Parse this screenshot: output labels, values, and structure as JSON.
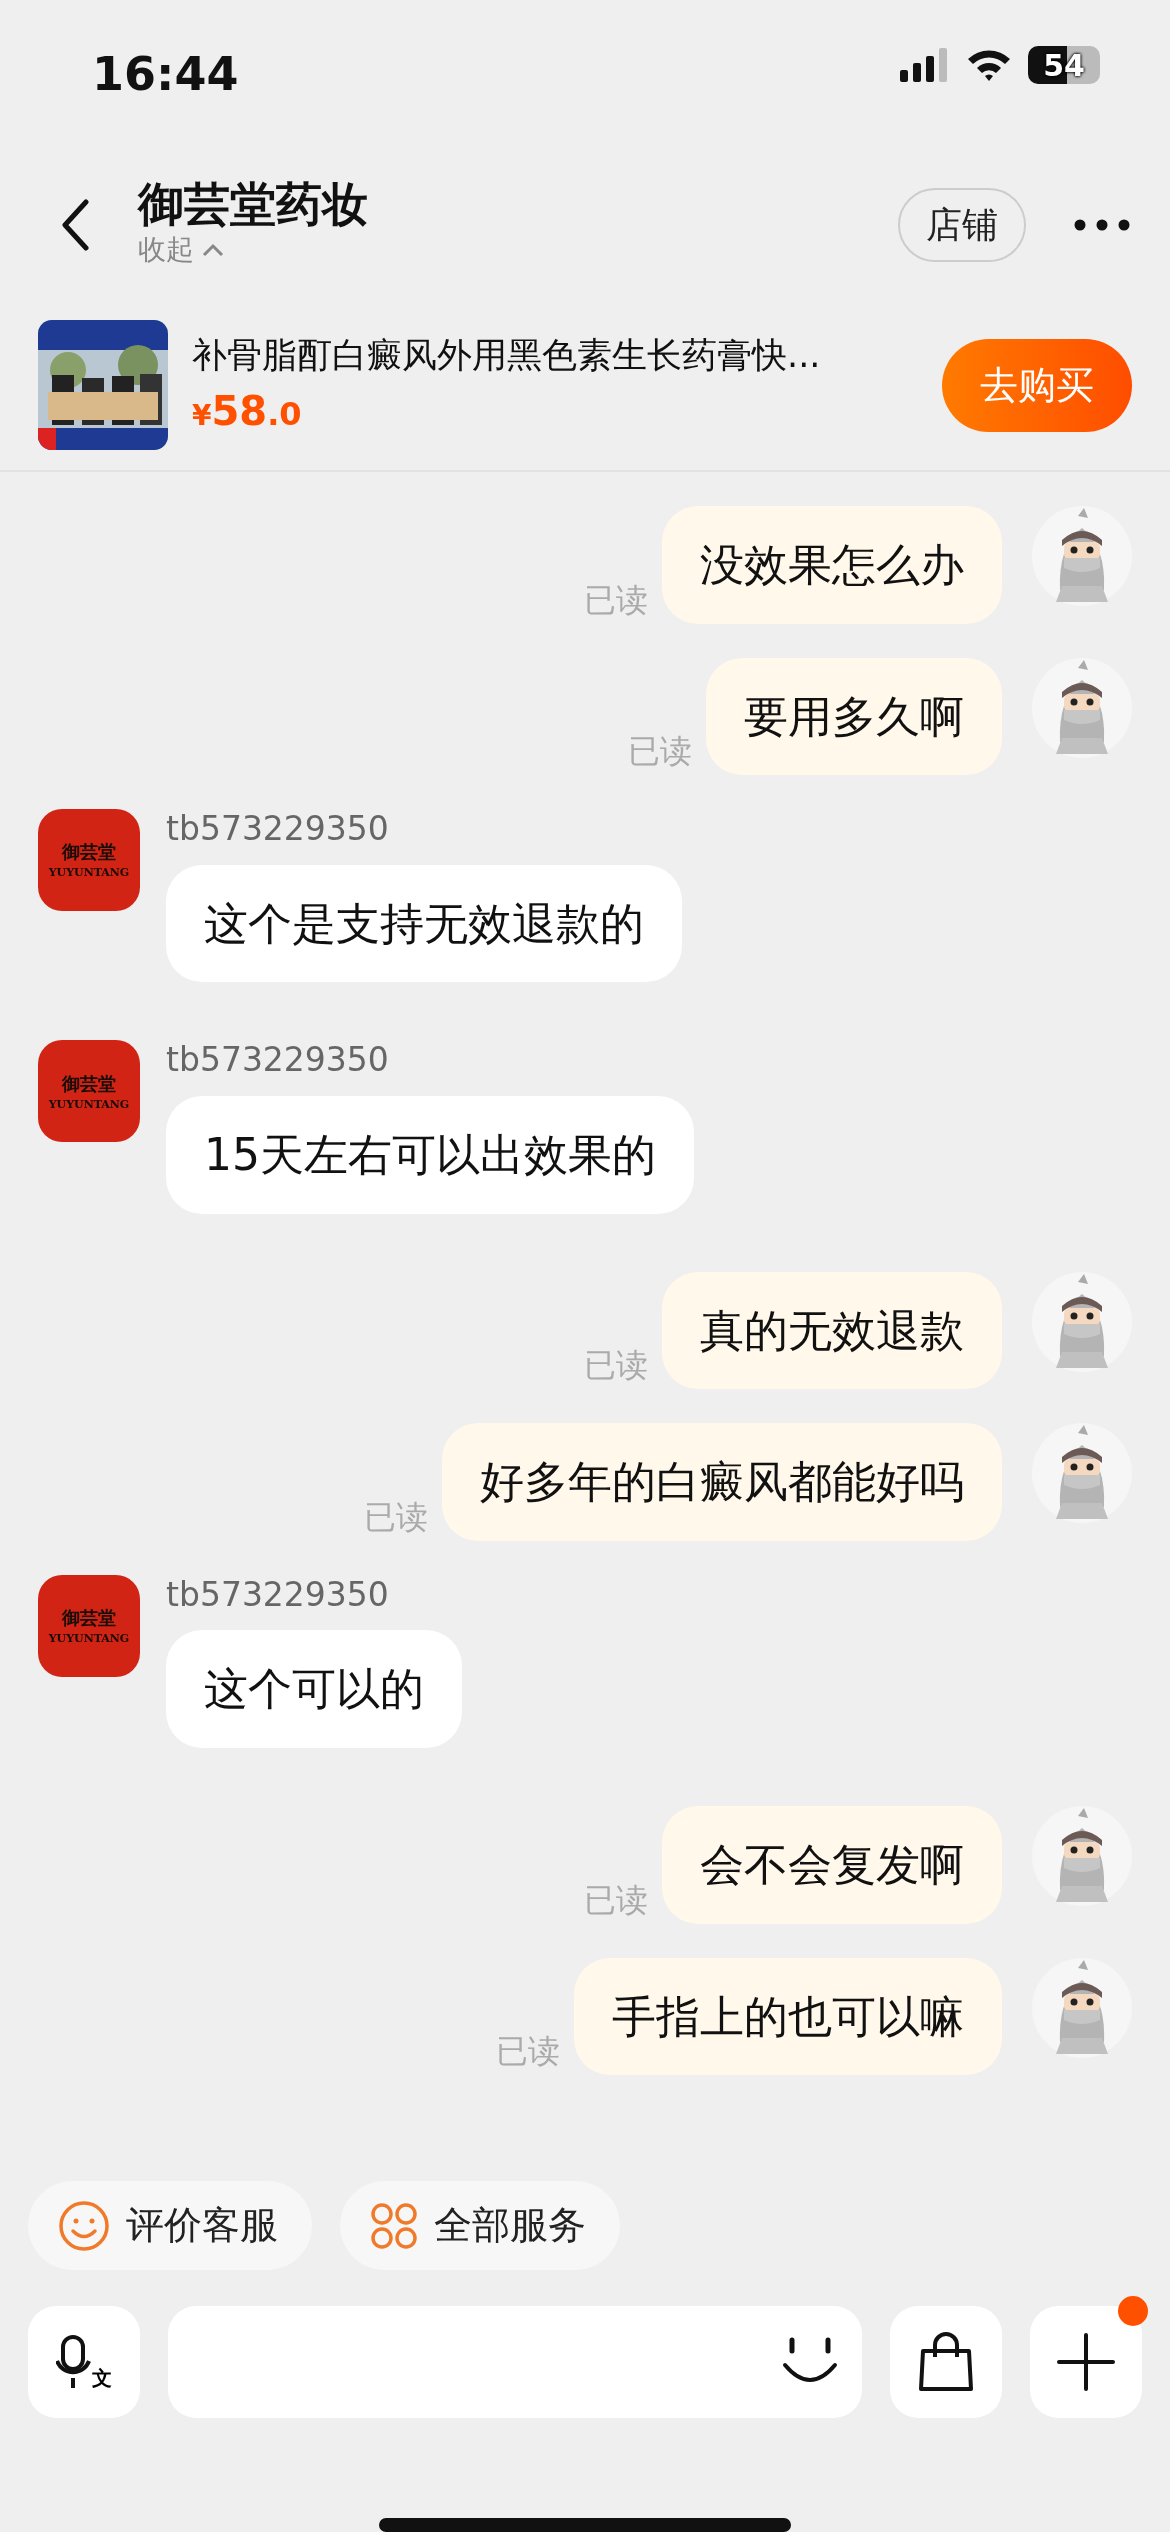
{
  "status_bar": {
    "time": "16:44",
    "battery": "54"
  },
  "header": {
    "title": "御芸堂药妆",
    "subtitle": "收起",
    "shop_button": "店铺"
  },
  "product": {
    "kind": "picture",
    "title": "补骨脂酊白癜风外用黑色素生长药膏快...",
    "currency": "¥",
    "price_int": "58",
    "price_dec": ".0",
    "buy_button": "去购买"
  },
  "messages": [
    {
      "kind": "sent",
      "text": "没效果怎么办",
      "status": "已读"
    },
    {
      "kind": "sent",
      "text": "要用多久啊",
      "status": "已读"
    },
    {
      "kind": "received",
      "avatar_cn": "御芸堂",
      "avatar_en": "YUYUNTANG",
      "sender": "tb573229350",
      "text": "这个是支持无效退款的"
    },
    {
      "kind": "received",
      "avatar_cn": "御芸堂",
      "avatar_en": "YUYUNTANG",
      "sender": "tb573229350",
      "text": "15天左右可以出效果的"
    },
    {
      "kind": "sent",
      "text": "真的无效退款",
      "status": "已读"
    },
    {
      "kind": "sent",
      "text": "好多年的白癜风都能好吗",
      "status": "已读"
    },
    {
      "kind": "received",
      "avatar_cn": "御芸堂",
      "avatar_en": "YUYUNTANG",
      "sender": "tb573229350",
      "text": "这个可以的"
    },
    {
      "kind": "sent",
      "text": "会不会复发啊",
      "status": "已读"
    },
    {
      "kind": "sent",
      "text": "手指上的也可以嘛",
      "status": "已读"
    }
  ],
  "quick_actions": [
    {
      "kind": "smile",
      "label": "评价客服"
    },
    {
      "kind": "grid",
      "label": "全部服务"
    }
  ],
  "input_bar": {
    "voice_glyph": "文",
    "plus_badge": true
  }
}
